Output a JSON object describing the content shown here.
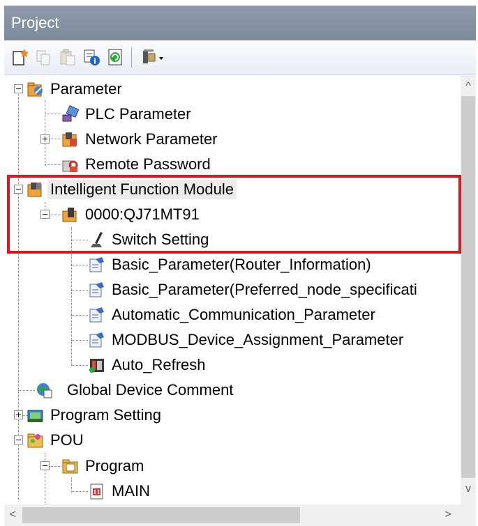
{
  "window": {
    "title": "Project"
  },
  "toolbar": {
    "buttons": [
      {
        "icon": "new-data-icon"
      },
      {
        "icon": "copy-icon"
      },
      {
        "icon": "paste-icon"
      },
      {
        "icon": "property-icon"
      },
      {
        "icon": "refresh-icon"
      },
      {
        "icon": "tools-dropdown-icon"
      }
    ]
  },
  "tree": {
    "items": [
      {
        "label": "Parameter",
        "icon": "parameter-folder-icon"
      },
      {
        "label": "PLC Parameter",
        "icon": "plc-parameter-icon"
      },
      {
        "label": "Network Parameter",
        "icon": "network-parameter-icon"
      },
      {
        "label": "Remote Password",
        "icon": "remote-password-icon"
      },
      {
        "label": "Intelligent Function Module",
        "icon": "intelligent-module-icon"
      },
      {
        "label": "0000:QJ71MT91",
        "icon": "module-icon"
      },
      {
        "label": "Switch Setting",
        "icon": "switch-setting-icon"
      },
      {
        "label": "Basic_Parameter(Router_Information)",
        "icon": "parameter-doc-icon"
      },
      {
        "label": "Basic_Parameter(Preferred_node_specificati",
        "icon": "parameter-doc-icon"
      },
      {
        "label": "Automatic_Communication_Parameter",
        "icon": "parameter-doc-icon"
      },
      {
        "label": "MODBUS_Device_Assignment_Parameter",
        "icon": "parameter-doc-icon"
      },
      {
        "label": "Auto_Refresh",
        "icon": "auto-refresh-icon"
      },
      {
        "label": "Global Device Comment",
        "icon": "global-comment-icon"
      },
      {
        "label": "Program Setting",
        "icon": "program-setting-icon"
      },
      {
        "label": "POU",
        "icon": "pou-folder-icon"
      },
      {
        "label": "Program",
        "icon": "program-folder-icon"
      },
      {
        "label": "MAIN",
        "icon": "main-program-icon"
      }
    ]
  },
  "scrollbar": {
    "up": "^",
    "down": "v",
    "left": "<",
    "right": ">"
  },
  "colors": {
    "titlebar": "#8794a5",
    "highlight": "#e0141e"
  }
}
